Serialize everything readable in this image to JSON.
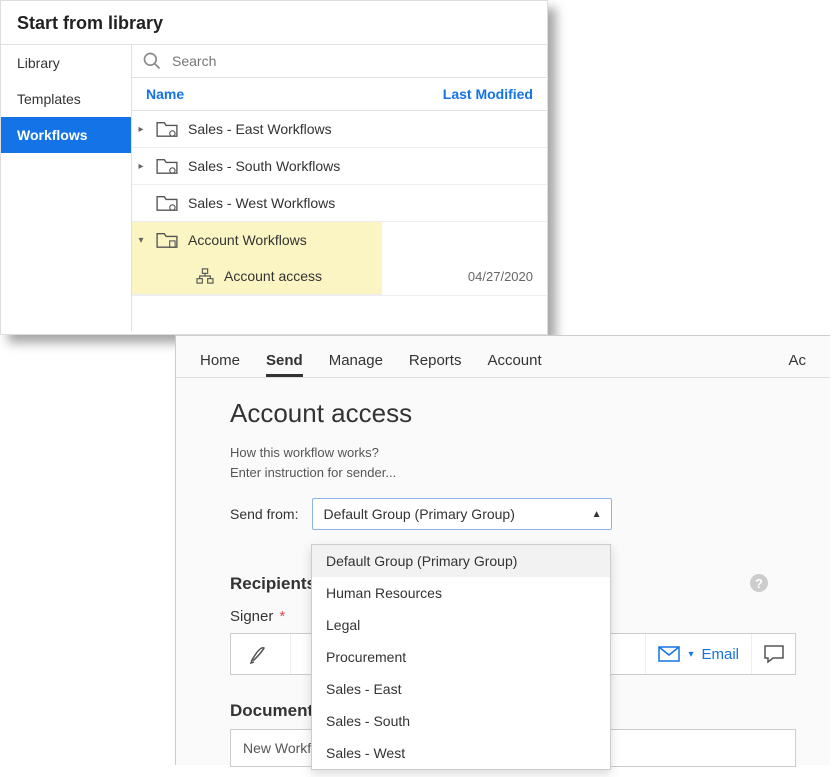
{
  "library": {
    "title": "Start from library",
    "sidebar": {
      "items": [
        {
          "label": "Library"
        },
        {
          "label": "Templates"
        },
        {
          "label": "Workflows"
        }
      ]
    },
    "search_placeholder": "Search",
    "columns": {
      "name": "Name",
      "modified": "Last Modified"
    },
    "folders": [
      {
        "label": "Sales - East Workflows"
      },
      {
        "label": "Sales - South Workflows"
      },
      {
        "label": "Sales - West Workflows"
      },
      {
        "label": "Account Workflows",
        "children": [
          {
            "label": "Account access",
            "date": "04/27/2020"
          }
        ]
      }
    ]
  },
  "send": {
    "nav": {
      "home": "Home",
      "send": "Send",
      "manage": "Manage",
      "reports": "Reports",
      "account": "Account",
      "right": "Ac"
    },
    "page_title": "Account access",
    "help1": "How this workflow works?",
    "help2": "Enter instruction for sender...",
    "sendfrom_label": "Send from:",
    "dropdown_selected": "Default Group (Primary Group)",
    "dropdown_options": [
      "Default Group (Primary Group)",
      "Human Resources",
      "Legal",
      "Procurement",
      "Sales - East",
      "Sales - South",
      "Sales - West"
    ],
    "recipients_heading": "Recipients",
    "signer_label": "Signer",
    "email_label": "Email",
    "documents_heading": "Document",
    "doc_value": "New Workflow"
  }
}
